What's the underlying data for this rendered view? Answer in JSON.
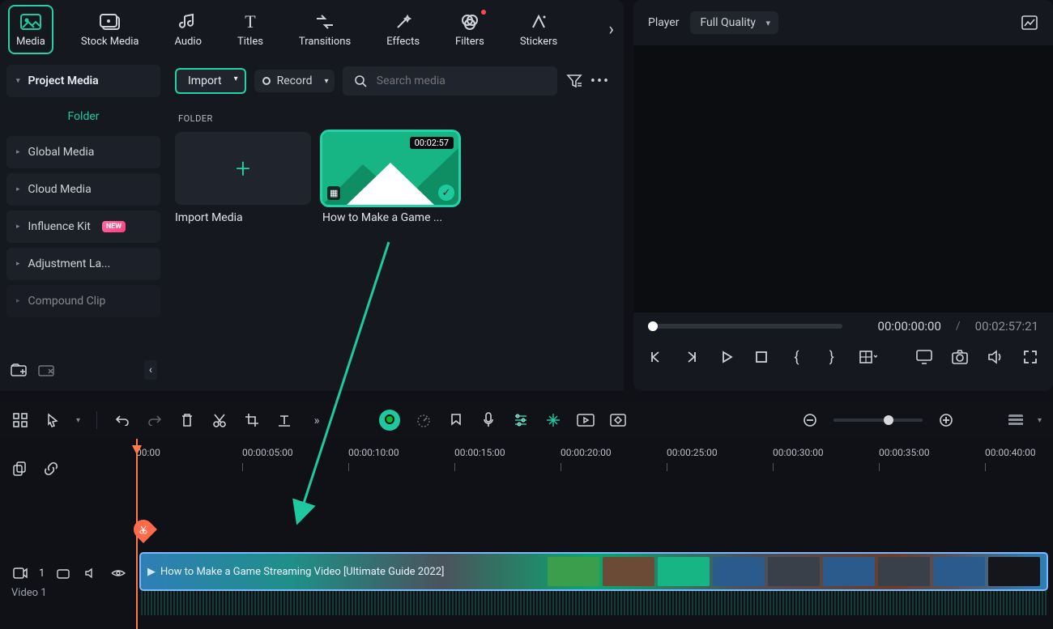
{
  "toptabs": {
    "items": [
      {
        "label": "Media"
      },
      {
        "label": "Stock Media"
      },
      {
        "label": "Audio"
      },
      {
        "label": "Titles"
      },
      {
        "label": "Transitions"
      },
      {
        "label": "Effects"
      },
      {
        "label": "Filters"
      },
      {
        "label": "Stickers"
      }
    ]
  },
  "player": {
    "title": "Player",
    "quality": "Full Quality",
    "time_current": "00:00:00:00",
    "time_sep": "/",
    "time_total": "00:02:57:21"
  },
  "sidebar": {
    "items": [
      {
        "label": "Project Media"
      },
      {
        "label": "Global Media"
      },
      {
        "label": "Cloud Media"
      },
      {
        "label": "Influence Kit",
        "badge": "NEW"
      },
      {
        "label": "Adjustment La..."
      },
      {
        "label": "Compound Clip"
      }
    ],
    "folder_link": "Folder"
  },
  "mid": {
    "import_btn": "Import",
    "record_btn": "Record",
    "search_placeholder": "Search media",
    "section_label": "FOLDER",
    "thumbs": [
      {
        "caption": "Import Media"
      },
      {
        "caption": "How to Make a Game ...",
        "duration": "00:02:57"
      }
    ]
  },
  "timeline": {
    "ticks": [
      "00:00",
      "00:00:05:00",
      "00:00:10:00",
      "00:00:15:00",
      "00:00:20:00",
      "00:00:25:00",
      "00:00:30:00",
      "00:00:35:00",
      "00:00:40:00"
    ],
    "track_count": "1",
    "track_name": "Video 1",
    "clip_title": "How to Make a Game Streaming Video [Ultimate Guide 2022]"
  }
}
